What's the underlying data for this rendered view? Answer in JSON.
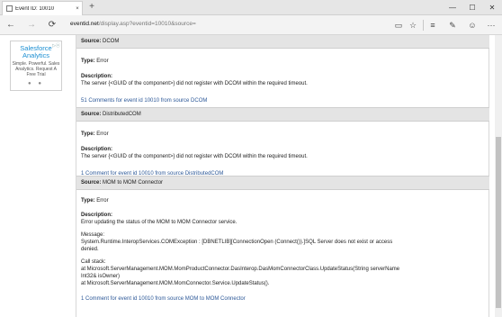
{
  "browser": {
    "tab_title": "Event ID: 10010",
    "tab_close": "×",
    "new_tab": "+",
    "window_controls": [
      "—",
      "☐",
      "✕"
    ],
    "nav": {
      "back": "←",
      "forward": "→",
      "refresh": "⟳"
    },
    "url_host": "eventid.net",
    "url_path": "/display.asp?eventid=10010&source=",
    "toolbar": {
      "reading": "▭",
      "favorite": "☆",
      "hub": "≡",
      "note": "✎",
      "share": "☺",
      "more": "···"
    }
  },
  "ad": {
    "choices": "▷ⓧ",
    "brand_line1": "Salesforce",
    "brand_line2": "Analytics",
    "tagline": "Simple. Powerful. Sales Analytics. Request A Free Trial",
    "dots": "● ●"
  },
  "sections": [
    {
      "source_label": "Source:",
      "source_value": "DCOM",
      "type_label": "Type:",
      "type_value": "Error",
      "description_label": "Description:",
      "description_text": "The server {<GUID of the component>} did not register with DCOM within the required timeout.",
      "link": "51 Comments for event id 10010 from source DCOM"
    },
    {
      "source_label": "Source:",
      "source_value": "DistributedCOM",
      "type_label": "Type:",
      "type_value": "Error",
      "description_label": "Description:",
      "description_text": "The server {<GUID of the component>} did not register with DCOM within the required timeout.",
      "link": "1 Comment for event id 10010 from source DistributedCOM"
    },
    {
      "source_label": "Source:",
      "source_value": "MOM to MOM Connector",
      "type_label": "Type:",
      "type_value": "Error",
      "description_label": "Description:",
      "description_text": "Error updating the status of the MOM to MOM Connector service.",
      "message_label": "Message:",
      "message_line1": "System.Runtime.InteropServices.COMException : [DBNETLIB][ConnectionOpen (Connect()).]SQL Server does not exist or access",
      "message_line2": "denied.",
      "callstack_label": "Call stack:",
      "callstack_line1": "at Microsoft.ServerManagement.MOM.MomProductConnector.DasInterop.DasMomConnectorClass.UpdateStatus(String serverName",
      "callstack_line2": "Int32& isOwner)",
      "callstack_line3": "at Microsoft.ServerManagement.MOM.MomConnector.Service.UpdateStatus().",
      "link": "1 Comment for event id 10010 from source MOM to MOM Connector"
    }
  ]
}
